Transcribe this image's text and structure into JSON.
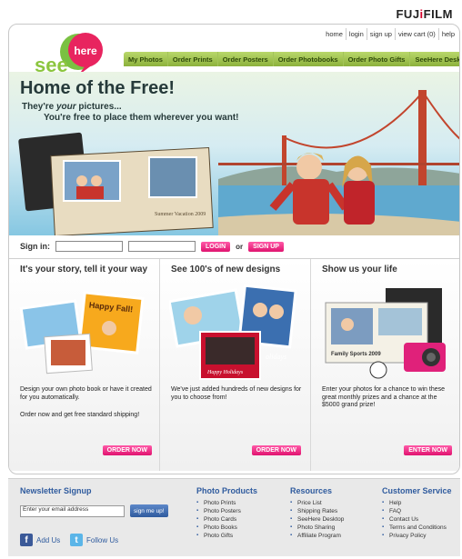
{
  "brand": {
    "name_part1": "FUJ",
    "name_part2": "i",
    "name_part3": "FILM"
  },
  "logo": {
    "bubble_text": "here",
    "word": "see"
  },
  "top_links": [
    "home",
    "login",
    "sign up",
    "view cart (0)",
    "help"
  ],
  "nav": [
    "My Photos",
    "Order Prints",
    "Order Posters",
    "Order Photobooks",
    "Order Photo Gifts",
    "SeeHere Desktop"
  ],
  "hero": {
    "title": "Home of the Free!",
    "sub1_a": "They're ",
    "sub1_b": "your",
    "sub1_c": " pictures...",
    "sub2": "You're free to place them wherever you want!",
    "book_caption": "Summer Vacation 2009"
  },
  "signin": {
    "label": "Sign in:",
    "login": "LOGIN",
    "or": "or",
    "signup": "SIGN UP"
  },
  "columns": [
    {
      "title": "It's your story, tell it your way",
      "art_text": "Happy Fall!",
      "desc": "Design your own photo book or have it created for you automatically.",
      "note": "Order now and get free standard shipping!",
      "button": "ORDER NOW"
    },
    {
      "title": "See 100's of new designs",
      "art_text": "Happy Holidays",
      "art_text2": "olidays",
      "desc": "We've just added hundreds of new designs for you to choose from!",
      "note": "",
      "button": "ORDER NOW"
    },
    {
      "title": "Show us your life",
      "art_text": "Family Sports 2009",
      "desc": "Enter your photos for a chance to win these great monthly prizes and a chance at the $5000 grand prize!",
      "note": "",
      "button": "ENTER NOW"
    }
  ],
  "footer": {
    "newsletter": {
      "title": "Newsletter Signup",
      "input_value": "Enter your email address",
      "button": "sign me up!"
    },
    "social": {
      "facebook": "Add Us",
      "twitter": "Follow Us"
    },
    "products": {
      "title": "Photo Products",
      "items": [
        "Photo Prints",
        "Photo Posters",
        "Photo Cards",
        "Photo Books",
        "Photo Gifts"
      ]
    },
    "resources": {
      "title": "Resources",
      "items": [
        "Price List",
        "Shipping Rates",
        "SeeHere Desktop",
        "Photo Sharing",
        "Affiliate Program"
      ]
    },
    "service": {
      "title": "Customer Service",
      "items": [
        "Help",
        "FAQ",
        "Contact Us",
        "Terms and Conditions",
        "Privacy Policy"
      ]
    }
  },
  "colors": {
    "accent_pink": "#e0136f",
    "nav_green": "#8cb13c",
    "footer_blue": "#2f5b9e"
  }
}
